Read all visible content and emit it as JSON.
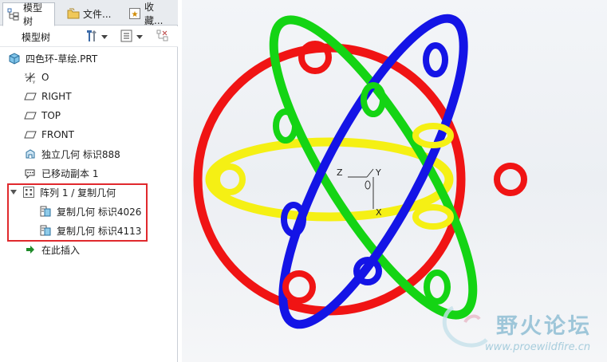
{
  "tabs": [
    {
      "label": "模型树",
      "icon": "model-tree-icon"
    },
    {
      "label": "文件...",
      "icon": "folder-icon"
    },
    {
      "label": "收藏...",
      "icon": "favorites-icon"
    }
  ],
  "toolbar": {
    "title": "模型树",
    "settings_icon": "tools-icon",
    "show_icon": "list-settings-icon",
    "filter_icon": "tree-filter-icon"
  },
  "tree": {
    "root": "四色环-草绘.PRT",
    "items": [
      {
        "label": "O",
        "icon": "csys-icon"
      },
      {
        "label": "RIGHT",
        "icon": "datum-plane-icon"
      },
      {
        "label": "TOP",
        "icon": "datum-plane-icon"
      },
      {
        "label": "FRONT",
        "icon": "datum-plane-icon"
      },
      {
        "label": "独立几何 标识888",
        "icon": "independent-geometry-icon"
      },
      {
        "label": "已移动副本 1",
        "icon": "moved-copy-icon"
      }
    ],
    "pattern": {
      "label": "阵列 1 / 复制几何",
      "children": [
        {
          "label": "复制几何 标识4026"
        },
        {
          "label": "复制几何 标识4113"
        }
      ]
    },
    "insert_here": "在此插入"
  },
  "viewport": {
    "csys_labels": {
      "z": "Z",
      "y": "Y",
      "x": "X"
    },
    "ring_colors": {
      "red": "#f01414",
      "green": "#14d414",
      "blue": "#1414e6",
      "yellow": "#f5f014"
    }
  },
  "watermark": {
    "title": "野火论坛",
    "url": "www.proewildfire.cn"
  }
}
